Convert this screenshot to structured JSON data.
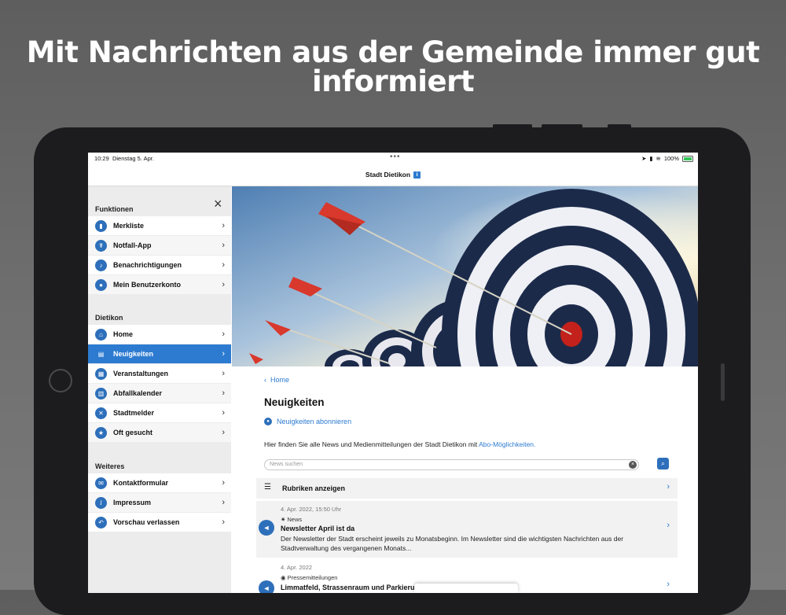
{
  "headline": {
    "line1": "Mit Nachrichten aus der Gemeinde immer gut",
    "line2": "informiert"
  },
  "statusbar": {
    "time": "10:29",
    "date": "Dienstag 5. Apr.",
    "dots": "•••",
    "battery": "100%"
  },
  "navbar": {
    "title": "Stadt Dietikon",
    "badge": "i"
  },
  "sidebar": {
    "close": "×",
    "sections": {
      "funktionen": "Funktionen",
      "dietikon": "Dietikon",
      "weiteres": "Weiteres"
    },
    "items": [
      {
        "label": "Merkliste",
        "icon": "bookmark-icon"
      },
      {
        "label": "Notfall-App",
        "icon": "emergency-icon"
      },
      {
        "label": "Benachrichtigungen",
        "icon": "bell-icon"
      },
      {
        "label": "Mein Benutzerkonto",
        "icon": "user-icon"
      },
      {
        "label": "Home",
        "icon": "home-icon"
      },
      {
        "label": "Neuigkeiten",
        "icon": "news-icon"
      },
      {
        "label": "Veranstaltungen",
        "icon": "calendar-icon"
      },
      {
        "label": "Abfallkalender",
        "icon": "trash-icon"
      },
      {
        "label": "Stadtmelder",
        "icon": "tools-icon"
      },
      {
        "label": "Oft gesucht",
        "icon": "star-icon"
      },
      {
        "label": "Kontaktformular",
        "icon": "mail-icon"
      },
      {
        "label": "Impressum",
        "icon": "info-icon"
      },
      {
        "label": "Vorschau verlassen",
        "icon": "back-arrow-icon"
      }
    ]
  },
  "content": {
    "breadcrumb": "Home",
    "title": "Neuigkeiten",
    "subscribe": "Neuigkeiten abonnieren",
    "intro": "Hier finden Sie alle News und Medienmitteilungen der Stadt Dietikon mit",
    "intro_link": "Abo-Möglichkeiten.",
    "search_placeholder": "News suchen",
    "rubriken": "Rubriken anzeigen",
    "news": [
      {
        "date": "4. Apr. 2022, 15:50 Uhr",
        "category": "News",
        "title": "Newsletter April ist da",
        "text": "Der Newsletter der Stadt erscheint jeweils zu Monatsbeginn. Im Newsletter sind die wichtigsten Nachrichten aus der Stadtverwaltung des vergangenen Monats..."
      },
      {
        "date": "4. Apr. 2022",
        "category": "Pressemitteilungen",
        "title": "Limmatfeld, Strassenraum und Parkierung",
        "text": ""
      }
    ]
  },
  "colors": {
    "accent": "#2d7bd1",
    "icon": "#2d6fba",
    "sidebar_bg": "#ececec"
  }
}
